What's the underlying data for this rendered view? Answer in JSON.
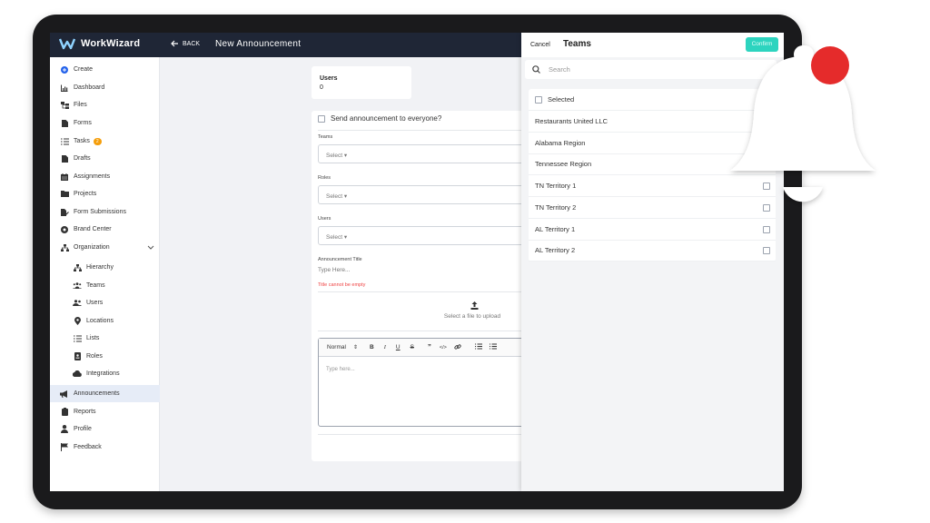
{
  "app": {
    "brand": "WorkWizard",
    "back_label": "BACK",
    "page_title": "New Announcement"
  },
  "sidebar": {
    "items": [
      {
        "label": "Create",
        "icon": "plus-circle-icon"
      },
      {
        "label": "Dashboard",
        "icon": "bar-chart-icon"
      },
      {
        "label": "Files",
        "icon": "files-icon"
      },
      {
        "label": "Forms",
        "icon": "document-icon"
      },
      {
        "label": "Tasks",
        "icon": "checklist-icon",
        "badge": "2"
      },
      {
        "label": "Drafts",
        "icon": "document-icon"
      },
      {
        "label": "Assignments",
        "icon": "calendar-icon"
      },
      {
        "label": "Projects",
        "icon": "folder-icon"
      },
      {
        "label": "Form Submissions",
        "icon": "pencil-document-icon"
      },
      {
        "label": "Brand Center",
        "icon": "brand-icon"
      },
      {
        "label": "Organization",
        "icon": "org-chart-icon"
      },
      {
        "label": "Hierarchy",
        "icon": "org-chart-icon"
      },
      {
        "label": "Teams",
        "icon": "team-icon"
      },
      {
        "label": "Users",
        "icon": "users-icon"
      },
      {
        "label": "Locations",
        "icon": "location-pin-icon"
      },
      {
        "label": "Lists",
        "icon": "list-icon"
      },
      {
        "label": "Roles",
        "icon": "id-badge-icon"
      },
      {
        "label": "Integrations",
        "icon": "cloud-icon"
      },
      {
        "label": "Announcements",
        "icon": "megaphone-icon"
      },
      {
        "label": "Reports",
        "icon": "clipboard-icon"
      },
      {
        "label": "Profile",
        "icon": "person-icon"
      },
      {
        "label": "Feedback",
        "icon": "flag-icon"
      }
    ]
  },
  "users_card": {
    "label": "Users",
    "value": "0"
  },
  "form": {
    "send_everyone_label": "Send announcement to everyone?",
    "teams_label": "Teams",
    "teams_value": "Select ▾",
    "roles_label": "Roles",
    "roles_value": "Select ▾",
    "users_label": "Users",
    "users_value": "Select ▾",
    "title_label": "Announcement Title",
    "title_placeholder": "Type Here...",
    "title_error": "Title cannot be empty",
    "upload_text": "Select a file to upload",
    "editor_format": "Normal",
    "editor_placeholder": "Type here..."
  },
  "panel": {
    "cancel_label": "Cancel",
    "title": "Teams",
    "confirm_label": "Confirm",
    "search_placeholder": "Search",
    "selected_label": "Selected",
    "teams": [
      "Restaurants United LLC",
      "Alabama Region",
      "Tennessee Region",
      "TN Territory 1",
      "TN Territory 2",
      "AL Territory 1",
      "AL Territory 2"
    ]
  },
  "colors": {
    "topbar": "#1f2636",
    "confirm": "#2dd4bf",
    "badge": "#f59e0b",
    "notification_dot": "#e52b2b",
    "error": "#ef4444"
  }
}
